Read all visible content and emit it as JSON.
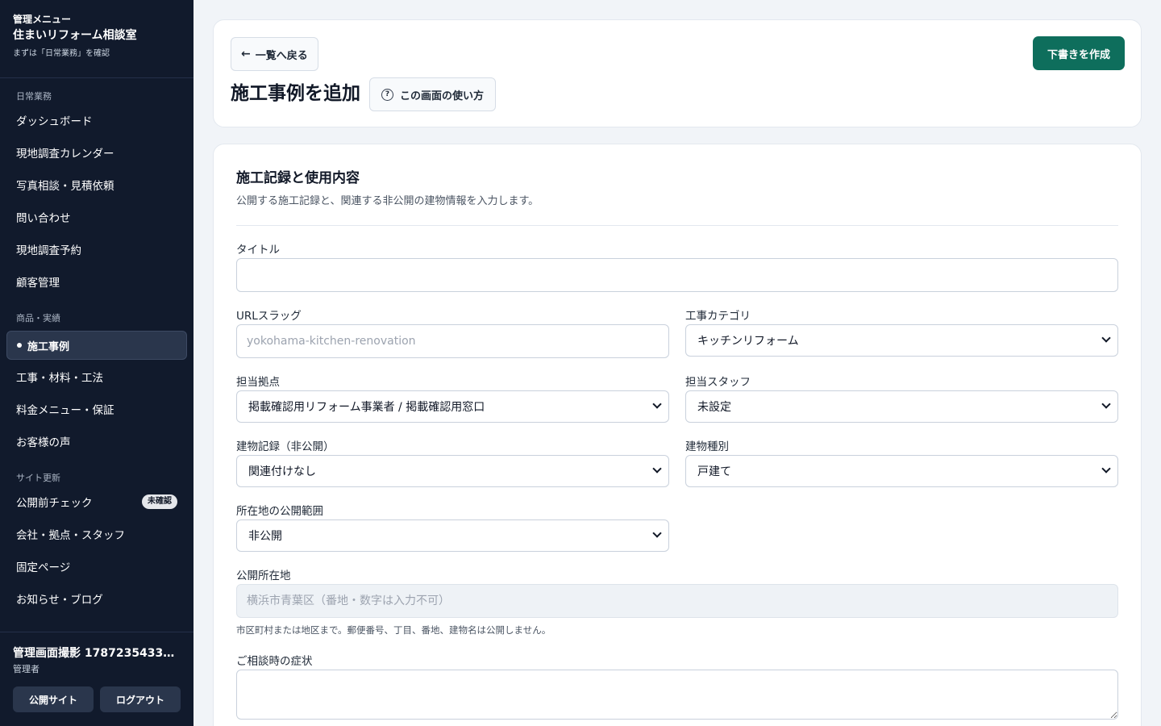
{
  "sidebar": {
    "menu_label": "管理メニュー",
    "title": "住まいリフォーム相談室",
    "subtitle": "まずは「日常業務」を確認",
    "sections": [
      {
        "label": "日常業務",
        "items": [
          "ダッシュボード",
          "現地調査カレンダー",
          "写真相談・見積依頼",
          "問い合わせ",
          "現地調査予約",
          "顧客管理"
        ]
      },
      {
        "label": "商品・実績",
        "items": [
          "施工事例",
          "工事・材料・工法",
          "料金メニュー・保証",
          "お客様の声"
        ]
      },
      {
        "label": "サイト更新",
        "items": [
          "公開前チェック",
          "会社・拠点・スタッフ",
          "固定ページ",
          "お知らせ・ブログ"
        ]
      }
    ],
    "active_item": "施工事例",
    "badge": "未確認",
    "user_name": "管理画面撮影 17872354334…",
    "user_role": "管理者",
    "public_site_button": "公開サイト",
    "logout_button": "ログアウト"
  },
  "header": {
    "back_label": "一覧へ戻る",
    "back_arrow": "←",
    "page_title": "施工事例を追加",
    "help_label": "この画面の使い方",
    "help_icon": "?",
    "draft_button": "下書きを作成"
  },
  "form": {
    "section_title": "施工記録と使用内容",
    "section_desc": "公開する施工記録と、関連する非公開の建物情報を入力します。",
    "title_label": "タイトル",
    "title_value": "",
    "slug_label": "URLスラッグ",
    "slug_placeholder": "yokohama-kitchen-renovation",
    "category_label": "工事カテゴリ",
    "category_value": "キッチンリフォーム",
    "branch_label": "担当拠点",
    "branch_value": "掲載確認用リフォーム事業者 / 掲載確認用窓口",
    "staff_label": "担当スタッフ",
    "staff_value": "未設定",
    "building_record_label": "建物記録（非公開）",
    "building_record_value": "関連付けなし",
    "building_type_label": "建物種別",
    "building_type_value": "戸建て",
    "location_scope_label": "所在地の公開範囲",
    "location_scope_value": "非公開",
    "public_location_label": "公開所在地",
    "public_location_placeholder": "横浜市青葉区（番地・数字は入力不可）",
    "public_location_hint": "市区町村または地区まで。郵便番号、丁目、番地、建物名は公開しません。",
    "symptom_label": "ご相談時の症状"
  }
}
